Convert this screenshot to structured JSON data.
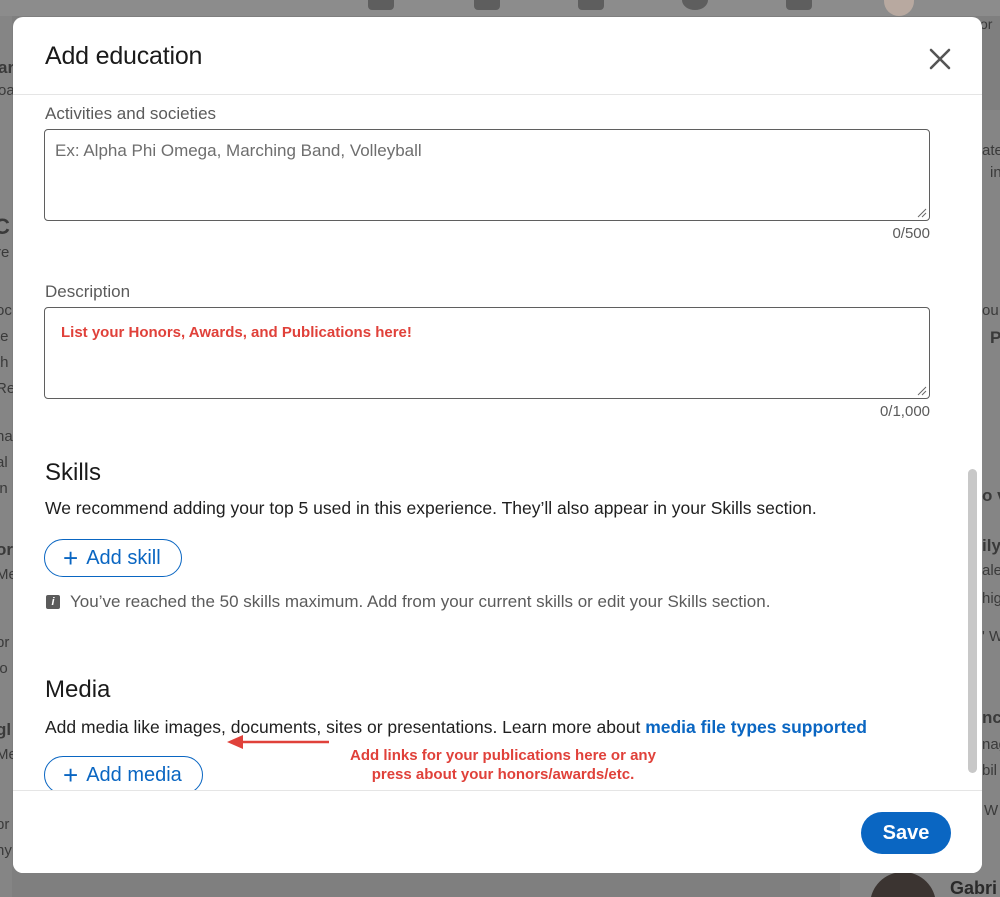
{
  "background": {
    "snippets": [
      "ar",
      "oa",
      "C",
      "re",
      "oc",
      "te",
      "th",
      "Re",
      "ha",
      "al",
      "in",
      "or",
      "Me",
      "br",
      "lo",
      "gl",
      "Me",
      "br",
      "ny"
    ],
    "right_snippets": [
      "or",
      "ate",
      "in",
      "ou",
      "P",
      "o v",
      "ily",
      "ale",
      "hig",
      "' W",
      "nc",
      "nag",
      "bil",
      "W"
    ],
    "bottom_name": "Gabri"
  },
  "modal": {
    "title": "Add education",
    "activities": {
      "label": "Activities and societies",
      "placeholder": "Ex: Alpha Phi Omega, Marching Band, Volleyball",
      "counter": "0/500"
    },
    "description": {
      "label": "Description",
      "note": "List your Honors, Awards, and Publications here!",
      "counter": "0/1,000"
    },
    "skills": {
      "title": "Skills",
      "description": "We recommend adding your top 5 used in this experience. They’ll also appear in your Skills section.",
      "button_label": "Add skill",
      "info": "You’ve reached the 50 skills maximum. Add from your current skills or edit your Skills section."
    },
    "media": {
      "title": "Media",
      "description": "Add media like images, documents, sites or presentations. Learn more about ",
      "link": "media file types supported",
      "button_label": "Add media",
      "annotation_line1": "Add links for your publications here or any",
      "annotation_line2": "press about your honors/awards/etc."
    },
    "save_label": "Save"
  },
  "colors": {
    "accent": "#0a66c2",
    "annotation": "#e0413a"
  }
}
